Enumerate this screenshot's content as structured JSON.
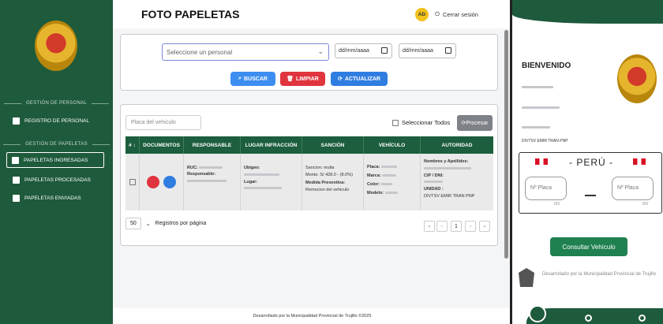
{
  "sidebar": {
    "section_personal": "GESTIÓN DE PERSONAL",
    "item_registro": "REGISTRO DE PERSONAL",
    "section_papeletas": "GESTIÓN DE PAPELETAS",
    "item_ingresadas": "PAPELETAS INGRESADAS",
    "item_procesadas": "PAPELETAS PROCESADAS",
    "item_enviadas": "PAPELETAS ENVIADAS"
  },
  "header": {
    "title": "FOTO PAPELETAS",
    "avatar": "AD",
    "logout": "Cerrar sesión"
  },
  "filters": {
    "personal_placeholder": "Seleccione un personal",
    "date_from": "dd/mm/aaaa",
    "date_to": "dd/mm/aaaa",
    "btn_buscar": "BUSCAR",
    "btn_limpiar": "LIMPIAR",
    "btn_actualizar": "ACTUALIZAR",
    "colors": {
      "buscar": "#3d8ef0",
      "limpiar": "#e0343e",
      "actualizar": "#2f7de1"
    }
  },
  "table": {
    "vehicle_placeholder": "Placa del vehículo",
    "select_all": "Seleccionar Todos",
    "procesar": "Procesar",
    "columns": [
      "# ↕",
      "DOCUMENTOS",
      "RESPONSABLE",
      "LUGAR INFRACCIÓN",
      "SANCIÓN",
      "VEHÍCULO",
      "AUTORIDAD"
    ],
    "row": {
      "ruc_label": "RUC:",
      "responsable_label": "Responsable:",
      "ubigeo_label": "Ubigeo:",
      "lugar_label": "Lugar:",
      "sancion": "Sancion: multa",
      "monto": "Monto: S/ 428.0 - (8.0%)",
      "medida_label": "Medida Preventiva:",
      "medida": "Remocion del vehiculo",
      "placa_label": "Placa:",
      "marca_label": "Marca:",
      "color_label": "Color:",
      "modelo_label": "Modelo:",
      "nombres_label": "Nombres y Apellidos:",
      "cip_label": "CIP / DNI:",
      "unidad_label": "UNIDAD :",
      "unidad": "DIVTSV EMIR TRAN PNP"
    },
    "page_size": "50",
    "per_page_label": "Registros por página",
    "page": "1"
  },
  "footer": "Desarrollado por la Municipalidad Provincial de Trujillo ©2025",
  "mobile": {
    "welcome": "BIENVENIDO",
    "unit": "DIVTSV EMIR TRAN PNP",
    "plate_title": "-  PERÚ  -",
    "placa1_placeholder": "Nº Placa",
    "placa2_placeholder": "Nº Placa",
    "count1": "0/3",
    "count2": "0/3",
    "consult": "Consultar Vehículo",
    "developed": "Desarrollado por la Municipalidad Provincial de Trujillo"
  }
}
